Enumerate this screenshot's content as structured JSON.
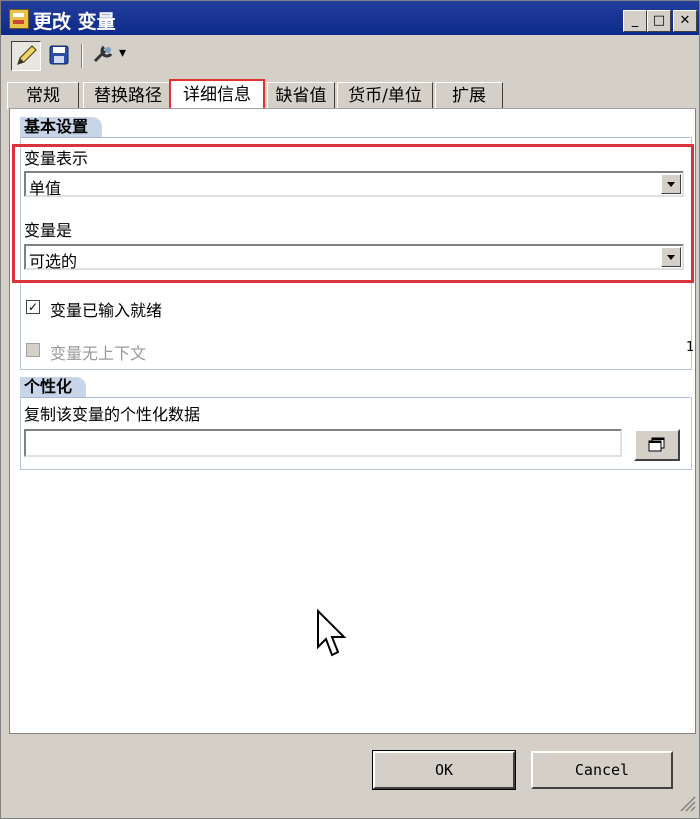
{
  "window": {
    "title": "更改 变量",
    "minimize_label": "_",
    "maximize_label": "□",
    "close_label": "✕"
  },
  "toolbar": {
    "icons": [
      "edit-icon",
      "save-icon",
      "tools-icon"
    ],
    "dropdown_glyph": "▾"
  },
  "tabs": [
    {
      "label": "常规"
    },
    {
      "label": "替换路径"
    },
    {
      "label": "详细信息",
      "active": true
    },
    {
      "label": "缺省值"
    },
    {
      "label": "货币/单位"
    },
    {
      "label": "扩展"
    }
  ],
  "basic_settings": {
    "header": "基本设置",
    "representation_label": "变量表示",
    "representation_value": "单值",
    "variable_is_label": "变量是",
    "variable_is_value": "可选的",
    "ready_checkbox_label": "变量已输入就绪",
    "ready_checked": true,
    "ready_check_glyph": "✓",
    "no_context_checkbox_label": "变量无上下文",
    "no_context_checked": false,
    "side_marker": "1"
  },
  "personalization": {
    "header": "个性化",
    "copy_label": "复制该变量的个性化数据",
    "copy_value": ""
  },
  "buttons": {
    "ok": "OK",
    "cancel": "Cancel"
  },
  "colors": {
    "highlight": "#d9343b",
    "title_bar": "#1a3591"
  }
}
